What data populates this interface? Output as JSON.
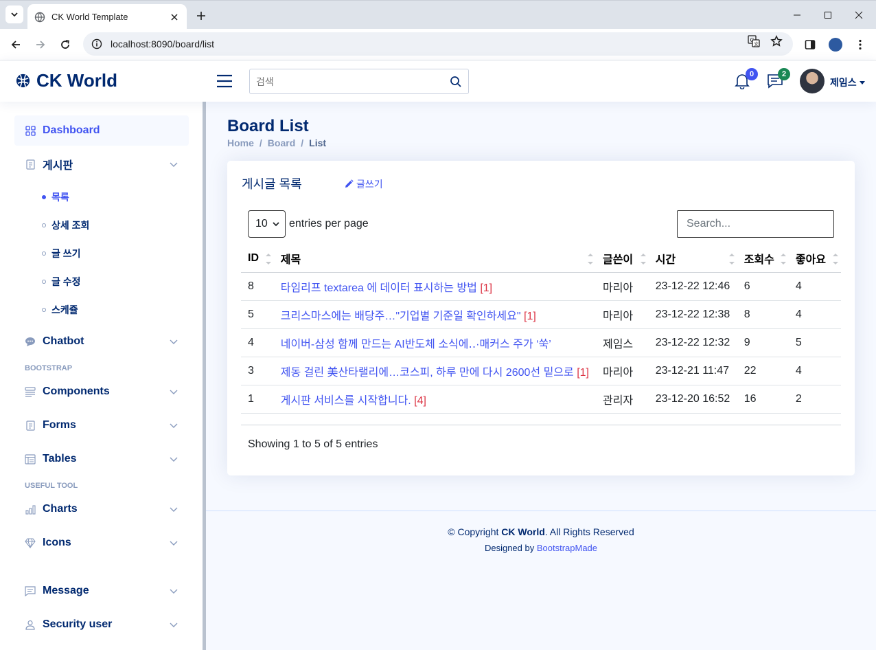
{
  "browser": {
    "tab_title": "CK World Template",
    "url": "localhost:8090/board/list"
  },
  "header": {
    "brand": "CK World",
    "search_placeholder": "검색",
    "notifications_count": "0",
    "messages_count": "2",
    "user_name": "제임스"
  },
  "sidebar": {
    "dashboard": "Dashboard",
    "board": "게시판",
    "board_items": [
      "목록",
      "상세 조회",
      "글 쓰기",
      "글 수정",
      "스케쥴"
    ],
    "chatbot": "Chatbot",
    "heading_bootstrap": "BOOTSTRAP",
    "components": "Components",
    "forms": "Forms",
    "tables": "Tables",
    "heading_useful": "USEFUL TOOL",
    "charts": "Charts",
    "icons": "Icons",
    "message": "Message",
    "security_user": "Security user"
  },
  "page": {
    "title": "Board List",
    "breadcrumb": [
      "Home",
      "Board",
      "List"
    ]
  },
  "card": {
    "title": "게시글 목록",
    "write_label": "글쓰기",
    "per_page_value": "10",
    "per_page_label": "entries per page",
    "search_placeholder": "Search...",
    "columns": [
      "ID",
      "제목",
      "글쓴이",
      "시간",
      "조회수",
      "좋아요"
    ],
    "rows": [
      {
        "id": "8",
        "title": "타임리프 textarea 에 데이터 표시하는 방법",
        "comments": "[1]",
        "author": "마리아",
        "time": "23-12-22 12:46",
        "views": "6",
        "likes": "4"
      },
      {
        "id": "5",
        "title": "크리스마스에는 배당주…\"기업별 기준일 확인하세요\"",
        "comments": "[1]",
        "author": "마리아",
        "time": "23-12-22 12:38",
        "views": "8",
        "likes": "4"
      },
      {
        "id": "4",
        "title": "네이버-삼성 함께 만드는 AI반도체 소식에‥·매커스 주가 ‘쑥’",
        "comments": "",
        "author": "제임스",
        "time": "23-12-22 12:32",
        "views": "9",
        "likes": "5"
      },
      {
        "id": "3",
        "title": "제동 걸린 美산타랠리에…코스피, 하루 만에 다시 2600선 밑으로",
        "comments": "[1]",
        "author": "마리아",
        "time": "23-12-21 11:47",
        "views": "22",
        "likes": "4"
      },
      {
        "id": "1",
        "title": "게시판 서비스를 시작합니다.",
        "comments": "[4]",
        "author": "관리자",
        "time": "23-12-20 16:52",
        "views": "16",
        "likes": "2"
      }
    ],
    "info": "Showing 1 to 5 of 5 entries"
  },
  "footer": {
    "copyright_prefix": "© Copyright ",
    "brand": "CK World",
    "copyright_suffix": ". All Rights Reserved",
    "designed_by": "Designed by ",
    "designer": "BootstrapMade"
  },
  "colors": {
    "primary": "#4154f1",
    "navy": "#012970",
    "muted": "#899bbd",
    "comment_red": "#dc3545",
    "badge_blue": "#4154f1",
    "badge_green": "#198754"
  }
}
